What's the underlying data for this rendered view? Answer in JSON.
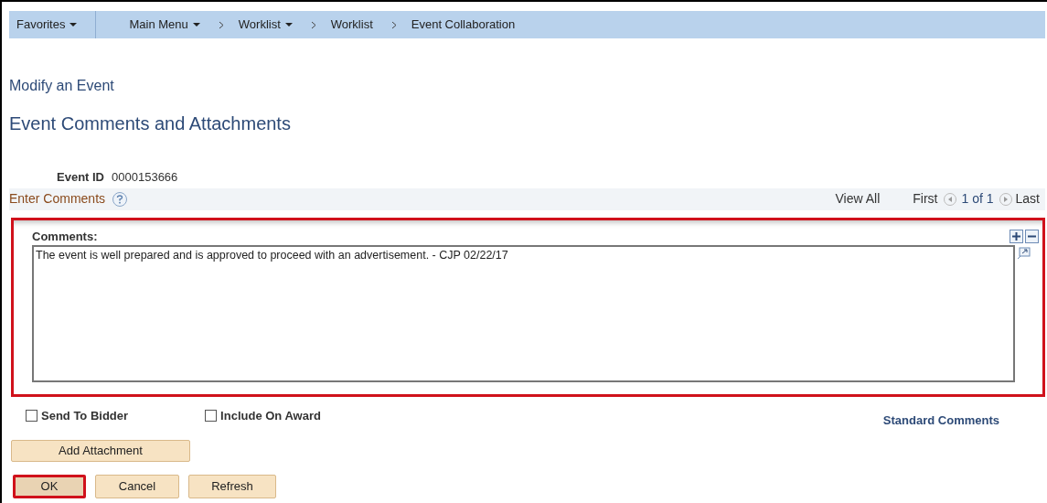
{
  "menus": [
    {
      "label": "Favorites",
      "dropdown": true
    },
    {
      "label": "Main Menu",
      "dropdown": true
    }
  ],
  "breadcrumbs": [
    {
      "label": "Worklist",
      "dropdown": true
    },
    {
      "label": "Worklist",
      "dropdown": false
    },
    {
      "label": "Event Collaboration",
      "dropdown": false
    }
  ],
  "page_title": "Modify an Event",
  "section_title": "Event Comments and Attachments",
  "event_id": {
    "label": "Event ID",
    "value": "0000153666"
  },
  "comments_header": {
    "title": "Enter Comments",
    "view_all": "View All",
    "first": "First",
    "position": "1 of 1",
    "last": "Last"
  },
  "comments": {
    "label": "Comments:",
    "value": "The event is well prepared and is approved to proceed with an advertisement. - CJP 02/22/17",
    "highlighted": true
  },
  "checkboxes": [
    {
      "label": "Send To Bidder",
      "checked": false
    },
    {
      "label": "Include On Award",
      "checked": false
    }
  ],
  "standard_comments_link": "Standard Comments",
  "attachment_button": "Add Attachment",
  "buttons": [
    {
      "label": "OK",
      "highlighted": true
    },
    {
      "label": "Cancel",
      "highlighted": false
    },
    {
      "label": "Refresh",
      "highlighted": false
    }
  ]
}
